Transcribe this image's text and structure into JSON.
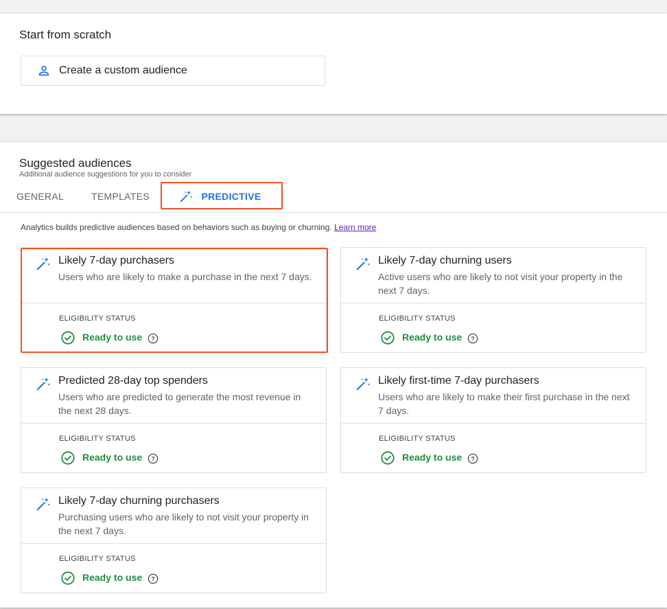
{
  "scratch": {
    "title": "Start from scratch",
    "custom_button_label": "Create a custom audience"
  },
  "suggested": {
    "title": "Suggested audiences",
    "subtitle": "Additional audience suggestions for you to consider",
    "tabs": [
      {
        "label": "GENERAL"
      },
      {
        "label": "TEMPLATES"
      },
      {
        "label": "PREDICTIVE"
      }
    ],
    "selected_tab": "PREDICTIVE",
    "info_text": "Analytics builds predictive audiences based on behaviors such as buying or churning.",
    "learn_more_label": "Learn more"
  },
  "cards": [
    {
      "title": "Likely 7-day purchasers",
      "description": "Users who are likely to make a purchase in the next 7 days.",
      "eligibility_label": "ELIGIBILITY STATUS",
      "status": "Ready to use",
      "highlighted": true
    },
    {
      "title": "Likely 7-day churning users",
      "description": "Active users who are likely to not visit your property in the next 7 days.",
      "eligibility_label": "ELIGIBILITY STATUS",
      "status": "Ready to use"
    },
    {
      "title": "Predicted 28-day top spenders",
      "description": "Users who are predicted to generate the most revenue in the next 28 days.",
      "eligibility_label": "ELIGIBILITY STATUS",
      "status": "Ready to use"
    },
    {
      "title": "Likely first-time 7-day purchasers",
      "description": "Users who are likely to make their first purchase in the next 7 days.",
      "eligibility_label": "ELIGIBILITY STATUS",
      "status": "Ready to use"
    },
    {
      "title": "Likely 7-day churning purchasers",
      "description": "Purchasing users who are likely to not visit your property in the next 7 days.",
      "eligibility_label": "ELIGIBILITY STATUS",
      "status": "Ready to use"
    }
  ],
  "icons": {
    "custom_audience": "person-icon",
    "predictive": "magic-wand-icon",
    "status": "check-circle-icon",
    "help": "help-icon"
  },
  "colors": {
    "accent": "#1a73e8",
    "highlight": "#f4511e",
    "ready": "#1e8e3e",
    "link": "#5b1fb2"
  }
}
